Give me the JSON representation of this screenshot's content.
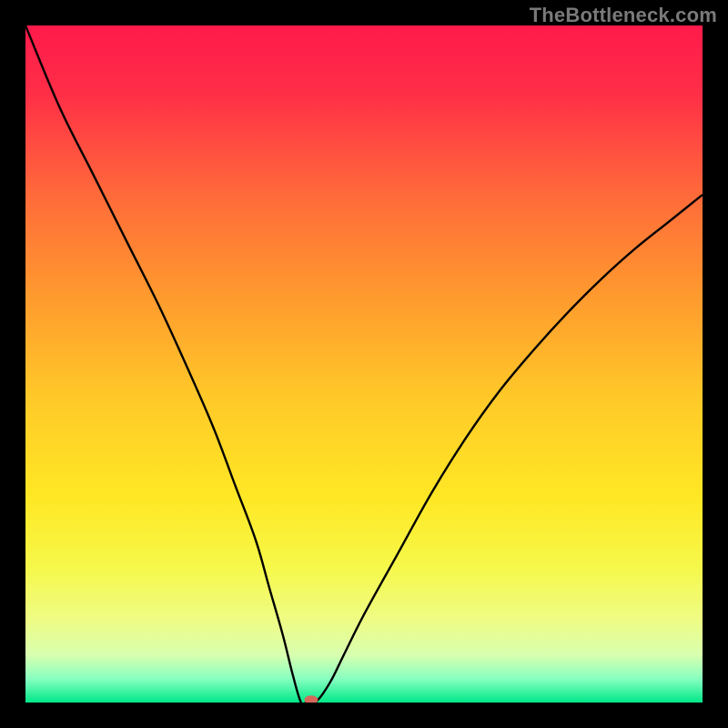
{
  "watermark": "TheBottleneck.com",
  "chart_data": {
    "type": "line",
    "title": "",
    "xlabel": "",
    "ylabel": "",
    "xlim": [
      0,
      100
    ],
    "ylim": [
      0,
      100
    ],
    "grid": false,
    "legend": false,
    "gradient_stops": [
      {
        "offset": 0.0,
        "color": "#ff1a4b"
      },
      {
        "offset": 0.1,
        "color": "#ff2e47"
      },
      {
        "offset": 0.25,
        "color": "#ff6a3a"
      },
      {
        "offset": 0.4,
        "color": "#ff9a2e"
      },
      {
        "offset": 0.55,
        "color": "#ffc928"
      },
      {
        "offset": 0.7,
        "color": "#ffe825"
      },
      {
        "offset": 0.8,
        "color": "#f6f84a"
      },
      {
        "offset": 0.88,
        "color": "#eefc86"
      },
      {
        "offset": 0.93,
        "color": "#d8ffb0"
      },
      {
        "offset": 0.965,
        "color": "#87ffc0"
      },
      {
        "offset": 1.0,
        "color": "#00e888"
      }
    ],
    "series": [
      {
        "name": "bottleneck-curve",
        "color": "#000000",
        "x": [
          0,
          5,
          10,
          15,
          20,
          25,
          28,
          31,
          34,
          36,
          38,
          39.5,
          40.7,
          41.5,
          43,
          45,
          47,
          50,
          55,
          60,
          65,
          70,
          75,
          80,
          85,
          90,
          95,
          100
        ],
        "y": [
          100,
          88,
          78,
          68,
          58,
          47,
          40,
          32,
          24,
          17,
          10,
          4,
          0,
          0,
          0.2,
          3,
          7,
          13,
          22,
          31,
          39,
          46,
          52,
          57.5,
          62.5,
          67,
          71,
          75
        ]
      }
    ],
    "markers": [
      {
        "name": "optimum-point",
        "x": 42.2,
        "y": 0.4,
        "color": "#d4695a",
        "rx": 1.0,
        "ry": 0.65
      }
    ]
  }
}
